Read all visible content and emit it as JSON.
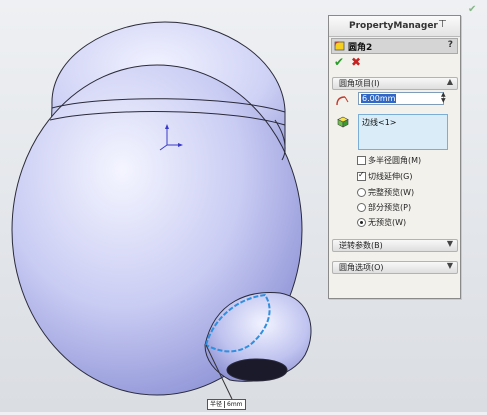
{
  "property_manager": {
    "title": "PropertyManager",
    "feature_name": "圆角2",
    "help": "?",
    "ok_icon": "check-icon",
    "cancel_icon": "close-icon",
    "groups": {
      "fillet_items": {
        "label": "圆角项目(I)",
        "chevron": "▲"
      },
      "setback": {
        "label": "逆转参数(B)",
        "chevron": "▼"
      },
      "fillet_options": {
        "label": "圆角选项(O)",
        "chevron": "▼"
      }
    },
    "radius_value": "6.00mm",
    "edge_list_item": "边线<1>",
    "options": [
      {
        "label": "多半径圆角(M)",
        "type": "checkbox",
        "checked": false
      },
      {
        "label": "切线延伸(G)",
        "type": "checkbox",
        "checked": true
      },
      {
        "label": "完整预览(W)",
        "type": "radio",
        "checked": false
      },
      {
        "label": "部分预览(P)",
        "type": "radio",
        "checked": false
      },
      {
        "label": "无预览(W)",
        "type": "radio",
        "checked": true
      }
    ]
  },
  "dimension_tag": {
    "label": "半径",
    "value": "6mm"
  },
  "colors": {
    "body_light": "#eef0ff",
    "body_dark": "#8a8fd8",
    "edge_highlight": "#2f8fe0",
    "ok": "#2a9d2a",
    "cancel": "#c62222"
  }
}
